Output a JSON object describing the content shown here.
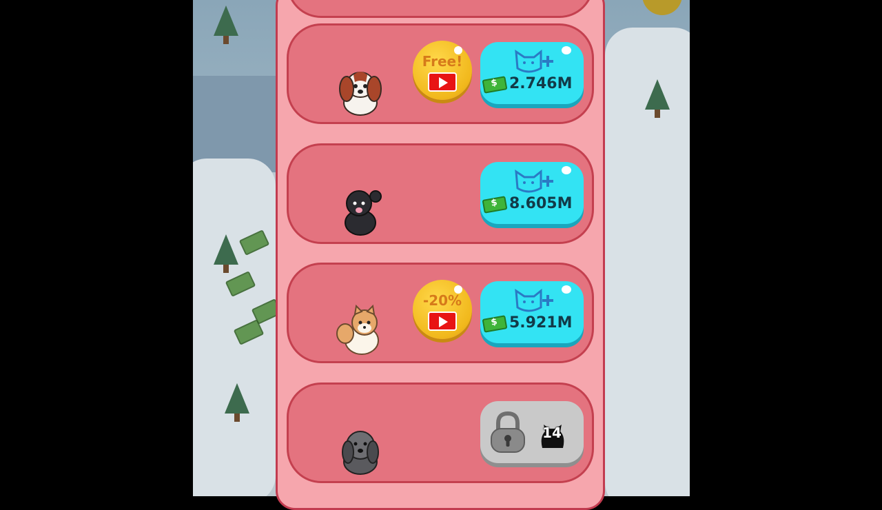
{
  "shop": {
    "items": [
      {
        "dog": "cavalier-king-charles-spaniel",
        "ad_offer": {
          "label": "Free!",
          "icon": "video-ad-icon"
        },
        "price": "2.746M",
        "locked": false
      },
      {
        "dog": "black-poodle",
        "ad_offer": null,
        "price": "8.605M",
        "locked": false
      },
      {
        "dog": "pomeranian",
        "ad_offer": {
          "label": "-20%",
          "icon": "video-ad-icon"
        },
        "price": "5.921M",
        "locked": false
      },
      {
        "dog": "shih-tzu",
        "ad_offer": null,
        "locked": true,
        "unlock_level": "14"
      }
    ]
  },
  "colors": {
    "panel_bg": "#f6a6ad",
    "card_bg": "#e4737f",
    "card_border": "#c4404f",
    "buy_button": "#33e3f3",
    "ad_button": "#f1b81c",
    "lock_button": "#c9c9c9"
  }
}
